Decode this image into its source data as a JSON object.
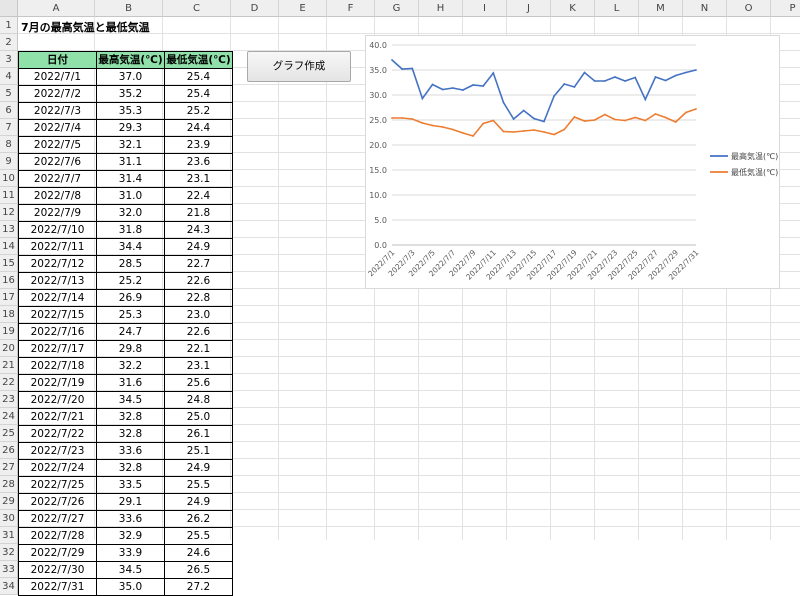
{
  "sheet": {
    "columns": [
      "A",
      "B",
      "C",
      "D",
      "E",
      "F",
      "G",
      "H",
      "I",
      "J",
      "K",
      "L",
      "M",
      "N",
      "O",
      "P"
    ],
    "rows": [
      "1",
      "2",
      "3",
      "4",
      "5",
      "6",
      "7",
      "8",
      "9",
      "10",
      "11",
      "12",
      "13",
      "14",
      "15",
      "16",
      "17",
      "18",
      "19",
      "20",
      "21",
      "22",
      "23",
      "24",
      "25",
      "26",
      "27",
      "28",
      "29",
      "30",
      "31",
      "32",
      "33",
      "34"
    ],
    "title": "7月の最高気温と最低気温",
    "headers": [
      "日付",
      "最高気温(℃)",
      "最低気温(℃)"
    ],
    "table": [
      [
        "2022/7/1",
        "37.0",
        "25.4"
      ],
      [
        "2022/7/2",
        "35.2",
        "25.4"
      ],
      [
        "2022/7/3",
        "35.3",
        "25.2"
      ],
      [
        "2022/7/4",
        "29.3",
        "24.4"
      ],
      [
        "2022/7/5",
        "32.1",
        "23.9"
      ],
      [
        "2022/7/6",
        "31.1",
        "23.6"
      ],
      [
        "2022/7/7",
        "31.4",
        "23.1"
      ],
      [
        "2022/7/8",
        "31.0",
        "22.4"
      ],
      [
        "2022/7/9",
        "32.0",
        "21.8"
      ],
      [
        "2022/7/10",
        "31.8",
        "24.3"
      ],
      [
        "2022/7/11",
        "34.4",
        "24.9"
      ],
      [
        "2022/7/12",
        "28.5",
        "22.7"
      ],
      [
        "2022/7/13",
        "25.2",
        "22.6"
      ],
      [
        "2022/7/14",
        "26.9",
        "22.8"
      ],
      [
        "2022/7/15",
        "25.3",
        "23.0"
      ],
      [
        "2022/7/16",
        "24.7",
        "22.6"
      ],
      [
        "2022/7/17",
        "29.8",
        "22.1"
      ],
      [
        "2022/7/18",
        "32.2",
        "23.1"
      ],
      [
        "2022/7/19",
        "31.6",
        "25.6"
      ],
      [
        "2022/7/20",
        "34.5",
        "24.8"
      ],
      [
        "2022/7/21",
        "32.8",
        "25.0"
      ],
      [
        "2022/7/22",
        "32.8",
        "26.1"
      ],
      [
        "2022/7/23",
        "33.6",
        "25.1"
      ],
      [
        "2022/7/24",
        "32.8",
        "24.9"
      ],
      [
        "2022/7/25",
        "33.5",
        "25.5"
      ],
      [
        "2022/7/26",
        "29.1",
        "24.9"
      ],
      [
        "2022/7/27",
        "33.6",
        "26.2"
      ],
      [
        "2022/7/28",
        "32.9",
        "25.5"
      ],
      [
        "2022/7/29",
        "33.9",
        "24.6"
      ],
      [
        "2022/7/30",
        "34.5",
        "26.5"
      ],
      [
        "2022/7/31",
        "35.0",
        "27.2"
      ]
    ],
    "button_label": "グラフ作成",
    "header_fill_color": "#8fe0a9"
  },
  "chart_data": {
    "type": "line",
    "x": [
      "2022/7/1",
      "2022/7/2",
      "2022/7/3",
      "2022/7/4",
      "2022/7/5",
      "2022/7/6",
      "2022/7/7",
      "2022/7/8",
      "2022/7/9",
      "2022/7/10",
      "2022/7/11",
      "2022/7/12",
      "2022/7/13",
      "2022/7/14",
      "2022/7/15",
      "2022/7/16",
      "2022/7/17",
      "2022/7/18",
      "2022/7/19",
      "2022/7/20",
      "2022/7/21",
      "2022/7/22",
      "2022/7/23",
      "2022/7/24",
      "2022/7/25",
      "2022/7/26",
      "2022/7/27",
      "2022/7/28",
      "2022/7/29",
      "2022/7/30",
      "2022/7/31"
    ],
    "x_tick_labels": [
      "2022/7/1",
      "2022/7/3",
      "2022/7/5",
      "2022/7/7",
      "2022/7/9",
      "2022/7/11",
      "2022/7/13",
      "2022/7/15",
      "2022/7/17",
      "2022/7/19",
      "2022/7/21",
      "2022/7/23",
      "2022/7/25",
      "2022/7/27",
      "2022/7/29",
      "2022/7/31"
    ],
    "y_tick_labels": [
      "0.0",
      "5.0",
      "10.0",
      "15.0",
      "20.0",
      "25.0",
      "30.0",
      "35.0",
      "40.0"
    ],
    "ylim": [
      0,
      40
    ],
    "grid": true,
    "legend_position": "right",
    "series": [
      {
        "name": "最高気温(℃)",
        "color": "#4472c4",
        "values": [
          37.0,
          35.2,
          35.3,
          29.3,
          32.1,
          31.1,
          31.4,
          31.0,
          32.0,
          31.8,
          34.4,
          28.5,
          25.2,
          26.9,
          25.3,
          24.7,
          29.8,
          32.2,
          31.6,
          34.5,
          32.8,
          32.8,
          33.6,
          32.8,
          33.5,
          29.1,
          33.6,
          32.9,
          33.9,
          34.5,
          35.0
        ]
      },
      {
        "name": "最低気温(℃)",
        "color": "#ed7d31",
        "values": [
          25.4,
          25.4,
          25.2,
          24.4,
          23.9,
          23.6,
          23.1,
          22.4,
          21.8,
          24.3,
          24.9,
          22.7,
          22.6,
          22.8,
          23.0,
          22.6,
          22.1,
          23.1,
          25.6,
          24.8,
          25.0,
          26.1,
          25.1,
          24.9,
          25.5,
          24.9,
          26.2,
          25.5,
          24.6,
          26.5,
          27.2
        ]
      }
    ]
  }
}
